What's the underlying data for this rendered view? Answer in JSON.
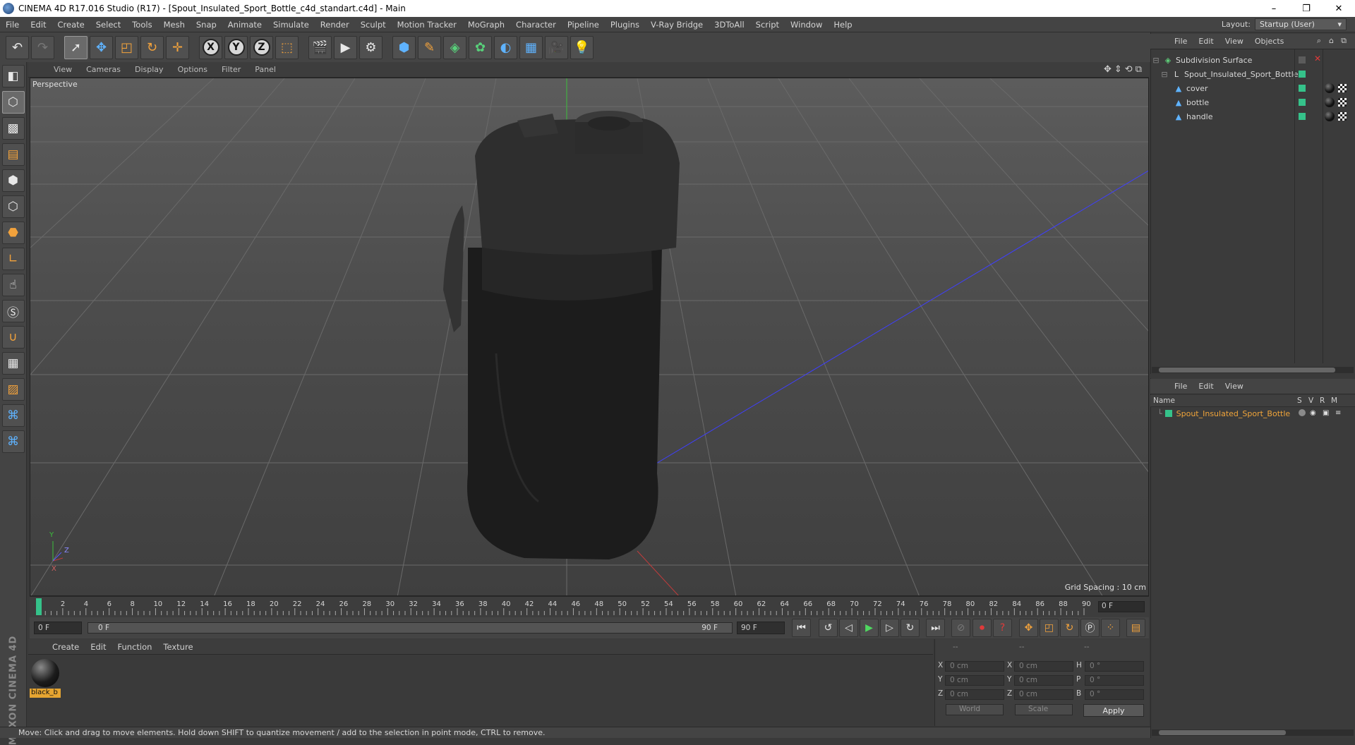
{
  "window": {
    "title": "CINEMA 4D R17.016 Studio (R17) - [Spout_Insulated_Sport_Bottle_c4d_standart.c4d] - Main",
    "controls": [
      "–",
      "❐",
      "✕"
    ]
  },
  "menubar": {
    "items": [
      "File",
      "Edit",
      "Create",
      "Select",
      "Tools",
      "Mesh",
      "Snap",
      "Animate",
      "Simulate",
      "Render",
      "Sculpt",
      "Motion Tracker",
      "MoGraph",
      "Character",
      "Pipeline",
      "Plugins",
      "V-Ray Bridge",
      "3DToAll",
      "Script",
      "Window",
      "Help"
    ],
    "layout_label": "Layout:",
    "layout_value": "Startup (User)"
  },
  "toolbar": {
    "axis_x": "X",
    "axis_y": "Y",
    "axis_z": "Z"
  },
  "viewport": {
    "menu": [
      "View",
      "Cameras",
      "Display",
      "Options",
      "Filter",
      "Panel"
    ],
    "label": "Perspective",
    "grid_spacing": "Grid Spacing : 10 cm",
    "axis_y_label": "Y",
    "axis_z_label": "Z",
    "axis_x_label": "X"
  },
  "timeline": {
    "ticks": [
      "0",
      "2",
      "4",
      "6",
      "8",
      "10",
      "12",
      "14",
      "16",
      "18",
      "20",
      "22",
      "24",
      "26",
      "28",
      "30",
      "32",
      "34",
      "36",
      "38",
      "40",
      "42",
      "44",
      "46",
      "48",
      "50",
      "52",
      "54",
      "56",
      "58",
      "60",
      "62",
      "64",
      "66",
      "68",
      "70",
      "72",
      "74",
      "76",
      "78",
      "80",
      "82",
      "84",
      "86",
      "88",
      "90"
    ],
    "current_frame": "0 F"
  },
  "transport": {
    "start_field": "0 F",
    "range_start": "0 F",
    "range_end": "90 F",
    "end_field": "90 F"
  },
  "materials": {
    "menu": [
      "Create",
      "Edit",
      "Function",
      "Texture"
    ],
    "items": [
      {
        "name": "black_b"
      }
    ]
  },
  "coordinates": {
    "header": [
      "--",
      "--",
      "--"
    ],
    "rows": [
      {
        "a_label": "X",
        "a_value": "0 cm",
        "b_label": "X",
        "b_value": "0 cm",
        "c_label": "H",
        "c_value": "0 °"
      },
      {
        "a_label": "Y",
        "a_value": "0 cm",
        "b_label": "Y",
        "b_value": "0 cm",
        "c_label": "P",
        "c_value": "0 °"
      },
      {
        "a_label": "Z",
        "a_value": "0 cm",
        "b_label": "Z",
        "b_value": "0 cm",
        "c_label": "B",
        "c_value": "0 °"
      }
    ],
    "mode_world": "World",
    "mode_scale": "Scale",
    "apply_label": "Apply"
  },
  "status": {
    "text": "Move: Click and drag to move elements. Hold down SHIFT to quantize movement / add to the selection in point mode, CTRL to remove."
  },
  "object_manager": {
    "menu": [
      "File",
      "Edit",
      "View",
      "Objects"
    ],
    "tree": [
      {
        "name": "Subdivision Surface",
        "level": 0
      },
      {
        "name": "Spout_Insulated_Sport_Bottle",
        "level": 1
      },
      {
        "name": "cover",
        "level": 2
      },
      {
        "name": "bottle",
        "level": 2
      },
      {
        "name": "handle",
        "level": 2
      }
    ]
  },
  "attribute_manager": {
    "menu": [
      "File",
      "Edit",
      "View"
    ],
    "columns": {
      "name": "Name",
      "s": "S",
      "v": "V",
      "r": "R",
      "m": "M"
    },
    "row": "Spout_Insulated_Sport_Bottle"
  },
  "colors": {
    "accent_orange": "#e6a531",
    "layer_green": "#35c28a",
    "axis_blue": "#3f3fff",
    "axis_green": "#3cbf3c",
    "axis_red": "#c03c3c"
  }
}
